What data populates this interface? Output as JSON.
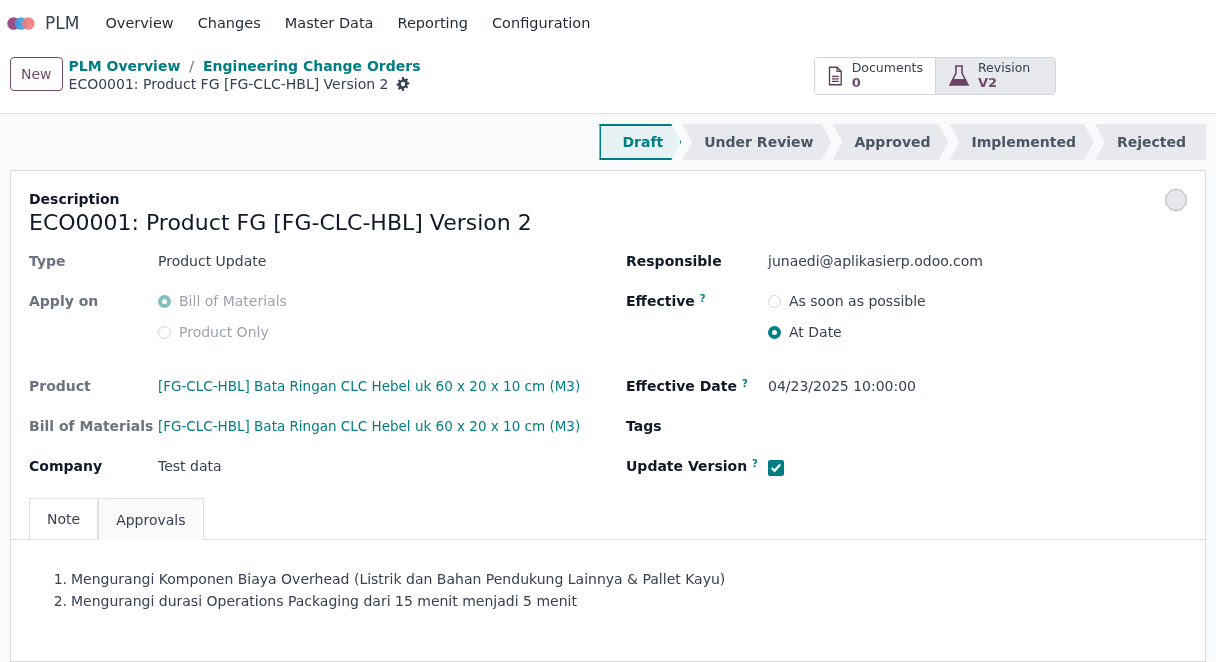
{
  "navbar": {
    "app_name": "PLM",
    "menu": [
      "Overview",
      "Changes",
      "Master Data",
      "Reporting",
      "Configuration"
    ]
  },
  "control_panel": {
    "new_button": "New",
    "breadcrumbs": [
      "PLM Overview",
      "Engineering Change Orders"
    ],
    "breadcrumb_separator": "/",
    "record_title": "ECO0001: Product FG [FG-CLC-HBL] Version 2",
    "smart_buttons": [
      {
        "kind": "document",
        "label": "Documents",
        "value": "0",
        "selected": false
      },
      {
        "kind": "flask",
        "label": "Revision",
        "value": "V2",
        "selected": true
      }
    ]
  },
  "status_bar": [
    {
      "label": "Draft",
      "selected": true
    },
    {
      "label": "Under Review",
      "selected": false
    },
    {
      "label": "Approved",
      "selected": false
    },
    {
      "label": "Implemented",
      "selected": false
    },
    {
      "label": "Rejected",
      "selected": false
    }
  ],
  "form": {
    "description_label": "Description",
    "name": "ECO0001: Product FG [FG-CLC-HBL] Version 2",
    "left_fields": [
      {
        "label": "Type",
        "kind": "text",
        "readonly": true,
        "value": "Product Update"
      },
      {
        "label": "Apply on",
        "kind": "radio",
        "readonly": true,
        "options": [
          {
            "label": "Bill of Materials",
            "selected": true
          },
          {
            "label": "Product Only",
            "selected": false
          }
        ]
      },
      {
        "label": "Product",
        "kind": "link",
        "readonly": true,
        "value": "[FG-CLC-HBL] Bata Ringan CLC Hebel uk 60 x 20 x 10 cm (M3)"
      },
      {
        "label": "Bill of Materials",
        "kind": "link",
        "readonly": true,
        "value": "[FG-CLC-HBL] Bata Ringan CLC Hebel uk 60 x 20 x 10 cm (M3)"
      },
      {
        "label": "Company",
        "kind": "text",
        "readonly": false,
        "value": "Test data"
      }
    ],
    "right_fields": [
      {
        "label": "Responsible",
        "kind": "text",
        "readonly": false,
        "value": "junaedi@aplikasierp.odoo.com"
      },
      {
        "label": "Effective",
        "kind": "radio",
        "readonly": false,
        "help": "?",
        "options": [
          {
            "label": "As soon as possible",
            "selected": false
          },
          {
            "label": "At Date",
            "selected": true
          }
        ]
      },
      {
        "label": "Effective Date",
        "kind": "text",
        "readonly": false,
        "help": "?",
        "value": "04/23/2025 10:00:00"
      },
      {
        "label": "Tags",
        "kind": "empty",
        "readonly": false
      },
      {
        "label": "Update Version",
        "kind": "checkbox",
        "readonly": false,
        "help": "?",
        "checked": true
      }
    ],
    "tabs": [
      {
        "label": "Note",
        "selected": true
      },
      {
        "label": "Approvals",
        "selected": false
      }
    ],
    "note_lines": [
      {
        "marker": "1.",
        "text": "Mengurangi Komponen Biaya Overhead (Listrik dan Bahan Pendukung Lainnya & Pallet Kayu)"
      },
      {
        "marker": "2.",
        "text": "Mengurangi durasi Operations Packaging dari 15 menit menjadi 5 menit"
      }
    ]
  }
}
